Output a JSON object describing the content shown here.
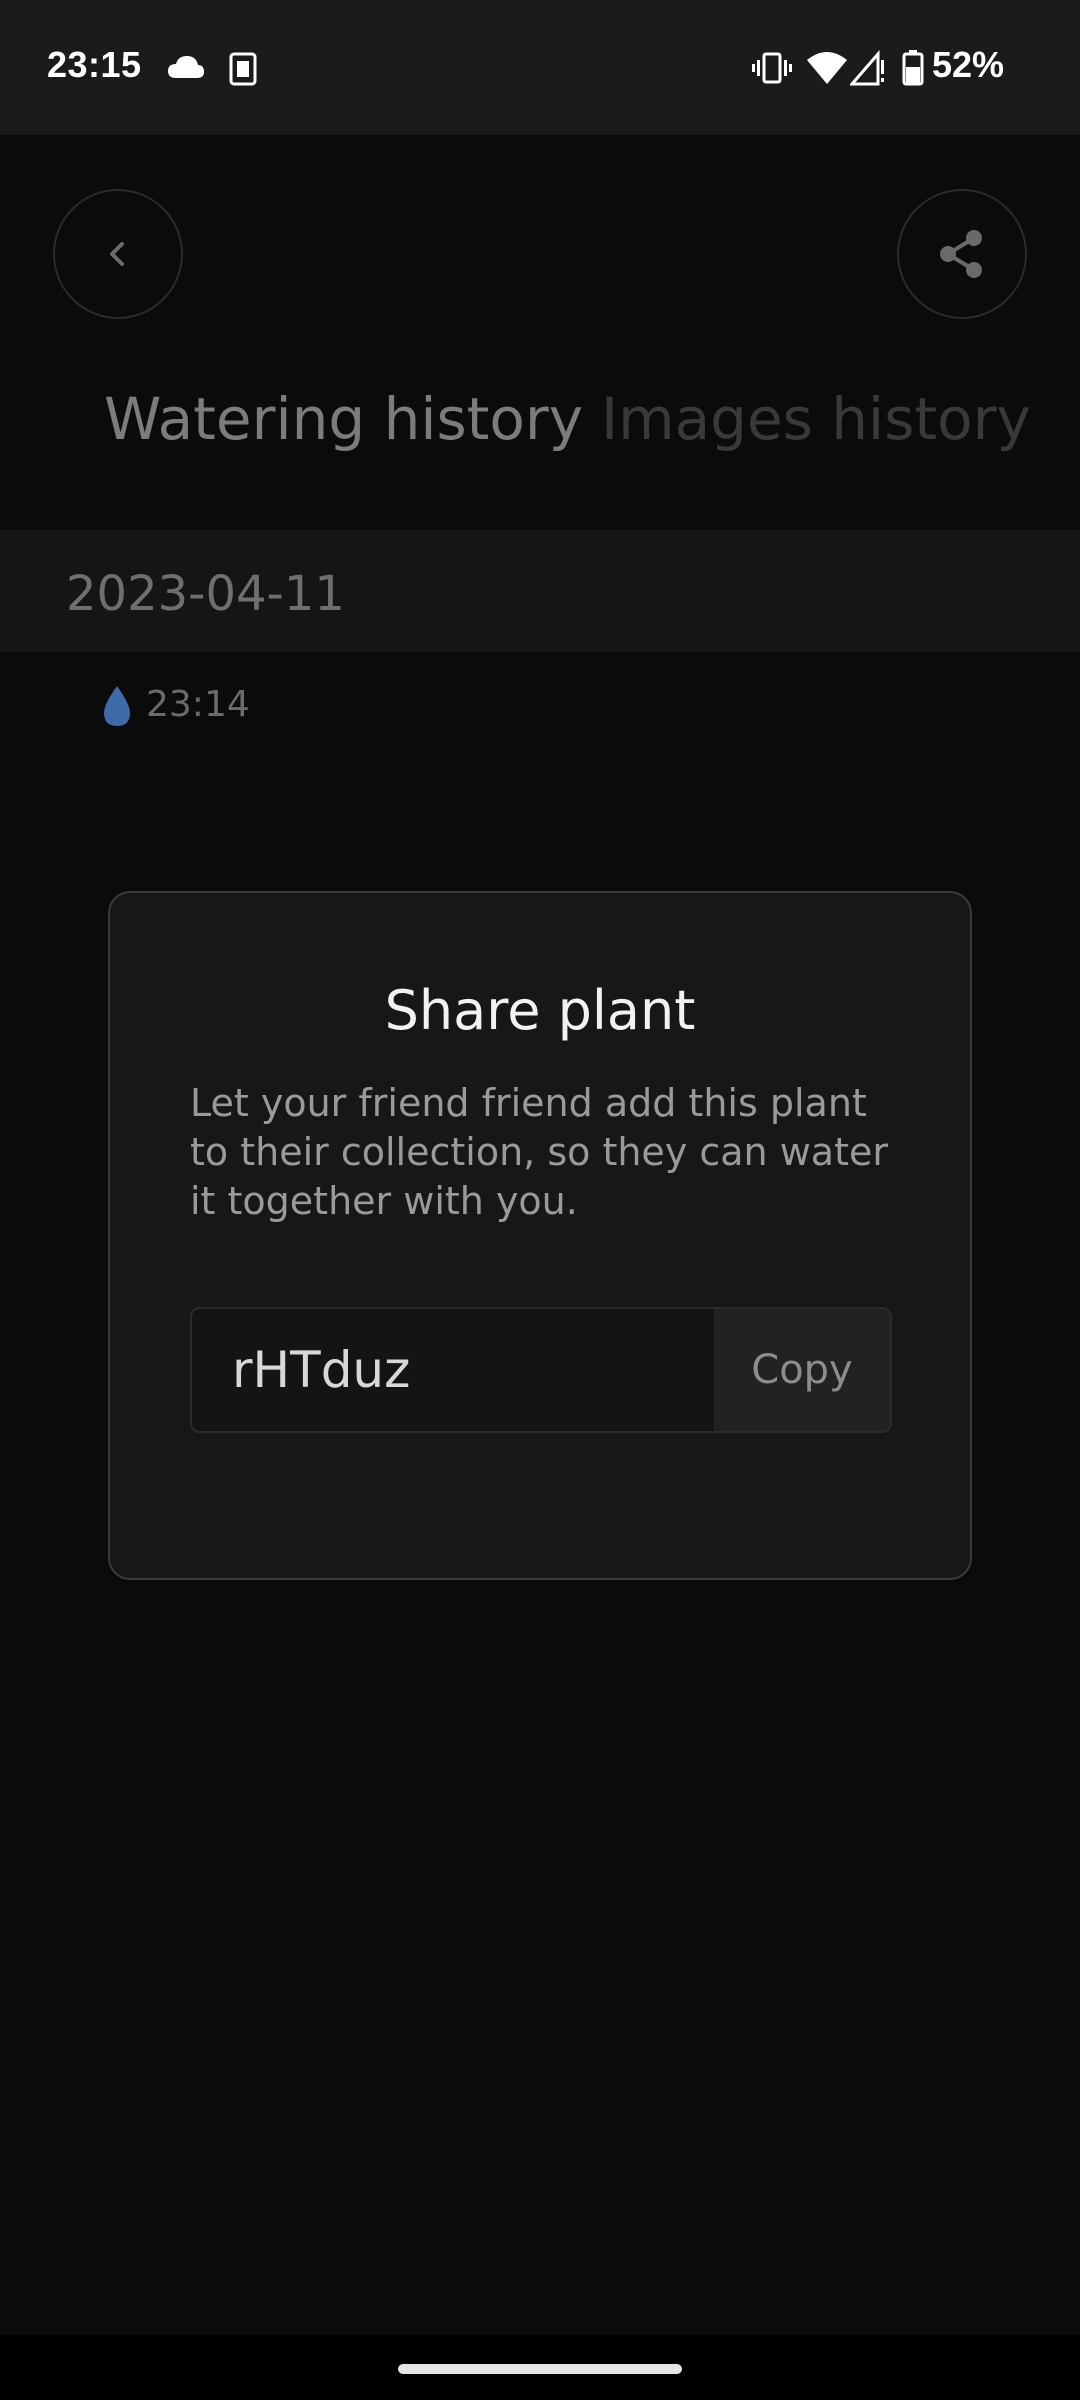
{
  "status_bar": {
    "time": "23:15",
    "battery_percent": "52%",
    "icons": [
      "cloud-icon",
      "sim-card-icon",
      "vibrate-icon",
      "wifi-icon",
      "signal-icon",
      "battery-icon"
    ]
  },
  "header": {
    "back_icon": "chevron-left-icon",
    "share_icon": "share-icon"
  },
  "tabs": [
    {
      "label": "Watering history",
      "active": true
    },
    {
      "label": "Images history",
      "active": false
    }
  ],
  "history": {
    "date": "2023-04-11",
    "entries": [
      {
        "icon": "water-drop-icon",
        "time": "23:14"
      }
    ]
  },
  "dialog": {
    "title": "Share plant",
    "description": "Let your friend friend add this plant to their collection, so they can water it together with you.",
    "code": "rHTduz",
    "copy_label": "Copy"
  },
  "colors": {
    "background": "#0b0b0b",
    "dialog_bg": "#171717",
    "water_drop": "#3f6aa8"
  }
}
